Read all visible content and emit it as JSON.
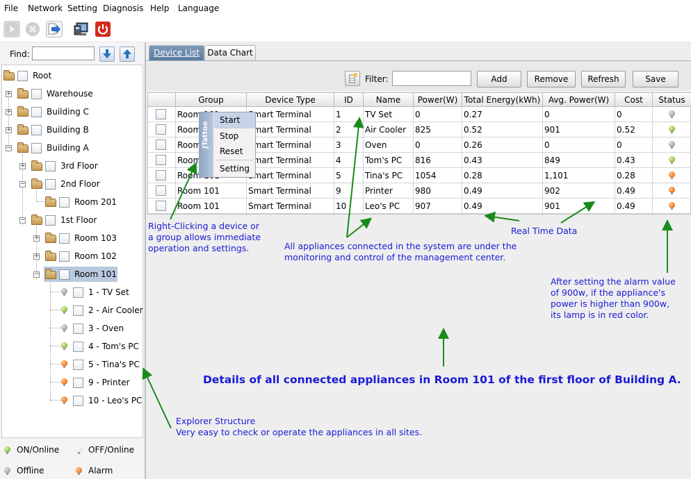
{
  "menu": [
    "File",
    "Network",
    "Setting",
    "Diagnosis",
    "Help",
    "Language"
  ],
  "toolbar": {
    "buttons": [
      "play-icon",
      "stop-icon",
      "import-icon",
      "monitor-icon",
      "power-icon"
    ]
  },
  "sidebar": {
    "find_label": "Find:",
    "find_value": "",
    "tree": {
      "root": "Root",
      "warehouse": "Warehouse",
      "building_c": "Building C",
      "building_b": "Building B",
      "building_a": "Building A",
      "floor3": "3rd Floor",
      "floor2": "2nd Floor",
      "room201": "Room 201",
      "floor1": "1st Floor",
      "room103": "Room 103",
      "room102": "Room 102",
      "room101": "Room 101",
      "devices": [
        "1 - TV Set",
        "2 - Air Cooler",
        "3 - Oven",
        "4 - Tom's PC",
        "5 - Tina's PC",
        "9 - Printer",
        "10 - Leo's PC"
      ]
    },
    "legend": {
      "on_online": "ON/Online",
      "off_online": "OFF/Online",
      "offline": "Offline",
      "alarm": "Alarm"
    }
  },
  "tabs": [
    "Device List",
    "Data Chart"
  ],
  "filter": {
    "label": "Filter:",
    "value": "",
    "buttons": [
      "Add",
      "Remove",
      "Refresh",
      "Save"
    ]
  },
  "table": {
    "headers": [
      "",
      "Group",
      "Device Type",
      "ID",
      "Name",
      "Power(W)",
      "Total Energy(kWh)",
      "Avg. Power(W)",
      "Cost",
      "Status"
    ],
    "rows": [
      {
        "group": "Room 101",
        "type": "Smart Terminal",
        "id": "1",
        "name": "TV Set",
        "power": "0",
        "energy": "0.27",
        "avg": "0",
        "cost": "0",
        "status": "offline"
      },
      {
        "group": "Room 101",
        "type": "Smart Terminal",
        "id": "2",
        "name": "Air Cooler",
        "power": "825",
        "energy": "0.52",
        "avg": "901",
        "cost": "0.52",
        "status": "on"
      },
      {
        "group": "Room 101",
        "type": "Smart Terminal",
        "id": "3",
        "name": "Oven",
        "power": "0",
        "energy": "0.26",
        "avg": "0",
        "cost": "0",
        "status": "offline"
      },
      {
        "group": "Room 101",
        "type": "Smart Terminal",
        "id": "4",
        "name": "Tom's PC",
        "power": "816",
        "energy": "0.43",
        "avg": "849",
        "cost": "0.43",
        "status": "on"
      },
      {
        "group": "Room 101",
        "type": "Smart Terminal",
        "id": "5",
        "name": "Tina's PC",
        "power": "1054",
        "energy": "0.28",
        "avg": "1,101",
        "cost": "0.28",
        "status": "alarm"
      },
      {
        "group": "Room 101",
        "type": "Smart Terminal",
        "id": "9",
        "name": "Printer",
        "power": "980",
        "energy": "0.49",
        "avg": "902",
        "cost": "0.49",
        "status": "alarm"
      },
      {
        "group": "Room 101",
        "type": "Smart Terminal",
        "id": "10",
        "name": "Leo's PC",
        "power": "907",
        "energy": "0.49",
        "avg": "901",
        "cost": "0.49",
        "status": "alarm"
      }
    ]
  },
  "context_menu": {
    "brand": "JTattoo",
    "items": [
      "Start",
      "Stop",
      "Reset",
      "Setting"
    ]
  },
  "device_status": [
    "offline",
    "on",
    "offline",
    "on",
    "alarm",
    "alarm",
    "alarm"
  ],
  "annotations": {
    "right_click": [
      "Right-Clicking a device or",
      "a group allows immediate",
      "operation and settings."
    ],
    "appliances": [
      "All appliances connected in the system are under the",
      "monitoring and control of the management center."
    ],
    "realtime": "Real Time Data",
    "alarm": [
      "After setting the alarm value",
      "of 900w, if the appliance's",
      "power is higher than 900w,",
      "its lamp is in red color."
    ],
    "headline": "Details of all connected appliances in Room 101 of the first floor of Building A.",
    "explorer": [
      "Explorer Structure",
      "Very easy to check or operate the appliances in all sites."
    ]
  },
  "colors": {
    "annotation": "#1a1ad6",
    "arrow": "#1a8a1a",
    "lamp_on": "#8bc34a",
    "lamp_alarm": "#f07b22",
    "lamp_offline": "#a8a8a8"
  }
}
